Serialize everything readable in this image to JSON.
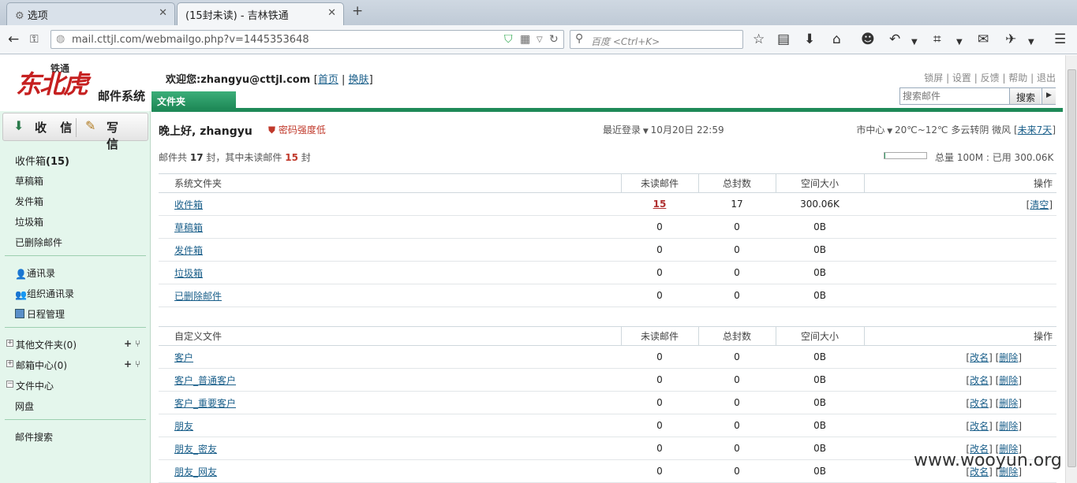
{
  "browser": {
    "tabs": [
      {
        "title": "选项"
      },
      {
        "title": "(15封未读) - 吉林铁通"
      }
    ],
    "url": "mail.cttjl.com/webmailgo.php?v=1445353648",
    "search_placeholder": "百度 <Ctrl+K>"
  },
  "header": {
    "logo_brand": "东北虎",
    "logo_tie": "铁通",
    "logo_system": "邮件系统",
    "welcome_prefix": "欢迎您:",
    "user_email": "zhangyu@cttjl.com",
    "home_link": "首页",
    "skin_link": "换肤",
    "top_links": [
      "锁屏",
      "设置",
      "反馈",
      "帮助",
      "退出"
    ],
    "folder_tab": "文件夹",
    "mail_search_placeholder": "搜索邮件",
    "mail_search_button": "搜索"
  },
  "sidebar": {
    "receive_label": "收 信",
    "write_label": "写 信",
    "inbox_label": "收件箱",
    "inbox_count": "(15)",
    "folders": [
      "草稿箱",
      "发件箱",
      "垃圾箱",
      "已删除邮件"
    ],
    "tools": [
      "通讯录",
      "组织通讯录",
      "日程管理"
    ],
    "tree": [
      "其他文件夹(0)",
      "邮箱中心(0)",
      "文件中心"
    ],
    "netdisk": "网盘",
    "mail_search": "邮件搜索"
  },
  "main": {
    "greeting": "晚上好, zhangyu",
    "password_warning": "密码强度低",
    "last_login_label": "最近登录",
    "last_login_time": "10月20日 22:59",
    "city": "市中心",
    "weather": "20℃~12℃ 多云转阴 微风",
    "forecast_link": "未来7天",
    "count_prefix": "邮件共",
    "total": "17",
    "count_mid": "封，其中未读邮件",
    "unread": "15",
    "count_suffix": "封",
    "quota_used_fraction": 0.003,
    "quota_text": "总量 100M : 已用 300.06K"
  },
  "system_table": {
    "headers": [
      "系统文件夹",
      "未读邮件",
      "总封数",
      "空间大小",
      "操作"
    ],
    "rows": [
      {
        "name": "收件箱",
        "unread": "15",
        "total": "17",
        "size": "300.06K",
        "op": "清空"
      },
      {
        "name": "草稿箱",
        "unread": "0",
        "total": "0",
        "size": "0B",
        "op": ""
      },
      {
        "name": "发件箱",
        "unread": "0",
        "total": "0",
        "size": "0B",
        "op": ""
      },
      {
        "name": "垃圾箱",
        "unread": "0",
        "total": "0",
        "size": "0B",
        "op": ""
      },
      {
        "name": "已删除邮件",
        "unread": "0",
        "total": "0",
        "size": "0B",
        "op": ""
      }
    ]
  },
  "custom_table": {
    "headers": [
      "自定义文件",
      "未读邮件",
      "总封数",
      "空间大小",
      "操作"
    ],
    "rename": "改名",
    "delete": "删除",
    "rows": [
      {
        "name": "客户",
        "unread": "0",
        "total": "0",
        "size": "0B"
      },
      {
        "name": "客户_普通客户",
        "unread": "0",
        "total": "0",
        "size": "0B"
      },
      {
        "name": "客户_重要客户",
        "unread": "0",
        "total": "0",
        "size": "0B"
      },
      {
        "name": "朋友",
        "unread": "0",
        "total": "0",
        "size": "0B"
      },
      {
        "name": "朋友_密友",
        "unread": "0",
        "total": "0",
        "size": "0B"
      },
      {
        "name": "朋友_网友",
        "unread": "0",
        "total": "0",
        "size": "0B"
      }
    ]
  },
  "watermark": "www.wooyun.org"
}
